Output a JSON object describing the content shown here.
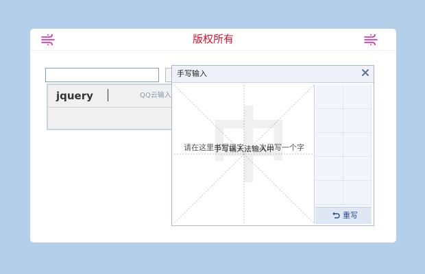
{
  "header": {
    "title": "版权所有",
    "title_color": "#d9102a",
    "left_icon": "wind-icon",
    "right_icon": "wind-icon"
  },
  "search": {
    "value": "",
    "placeholder": ""
  },
  "suggestion": {
    "text": "jquery",
    "tag": "QQ云输入"
  },
  "handwriting": {
    "title": "手写输入",
    "close_icon": "close-icon",
    "watermark": "中",
    "hint": "请在这里书写汉字，一次只写一个字",
    "hint_overlay": "手写输入法输入中",
    "rewrite_label": "重写",
    "rewrite_icon": "undo-icon"
  },
  "colors": {
    "background": "#b3cfe9",
    "panel_border": "#a6b5d6",
    "candidate_bg": "#f2f6fc"
  }
}
